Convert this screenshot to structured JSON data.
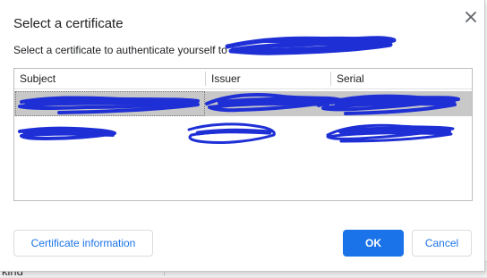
{
  "dialog": {
    "title": "Select a certificate",
    "subtitle": "Select a certificate to authenticate yourself to",
    "close_icon": "close-icon"
  },
  "table": {
    "columns": [
      "Subject",
      "Issuer",
      "Serial"
    ],
    "selected_row": 0,
    "row_count": 2
  },
  "buttons": {
    "info_label": "Certificate information",
    "ok_label": "OK",
    "cancel_label": "Cancel"
  },
  "background": {
    "partial_text": "kind"
  },
  "colors": {
    "accent": "#1a73e8",
    "redaction": "#1e2fd6",
    "selected_row": "#c8c8c8"
  }
}
